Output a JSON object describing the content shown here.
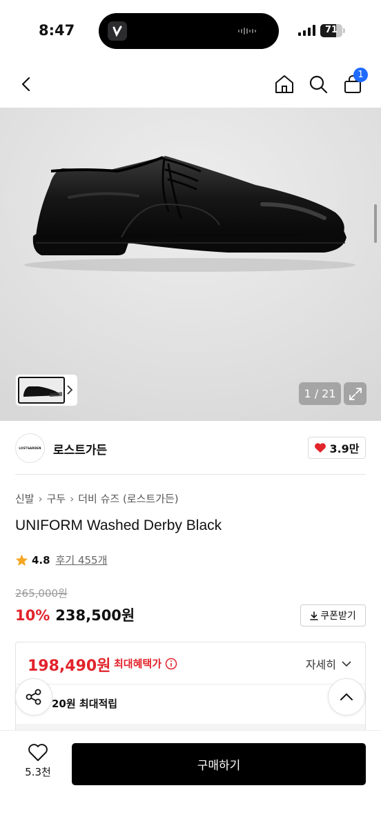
{
  "status_bar": {
    "time": "8:47",
    "battery": "71",
    "battery_level": 0.71
  },
  "nav": {
    "cart_count": "1"
  },
  "gallery": {
    "counter": "1 / 21"
  },
  "brand": {
    "logo_text": "LOSTGARDEN",
    "name": "로스트가든",
    "likes": "3.9만"
  },
  "breadcrumb": [
    "신발",
    "구두",
    "더비 슈즈 (로스트가든)"
  ],
  "product": {
    "title": "UNIFORM Washed Derby Black",
    "rating": "4.8",
    "reviews": "후기 455개",
    "original_price": "265,000원",
    "discount": "10%",
    "sale_price": "238,500원",
    "coupon_label": "쿠폰받기"
  },
  "benefit": {
    "price": "198,490원",
    "label": "최대혜택가",
    "detail": "자세히",
    "points": "20원 최대적립"
  },
  "bottom_bar": {
    "wish_count": "5.3천",
    "buy_label": "구매하기"
  },
  "colors": {
    "accent_red": "#e2232b",
    "badge_blue": "#1f6bff",
    "buy_black": "#000000",
    "star": "#f5a623"
  }
}
